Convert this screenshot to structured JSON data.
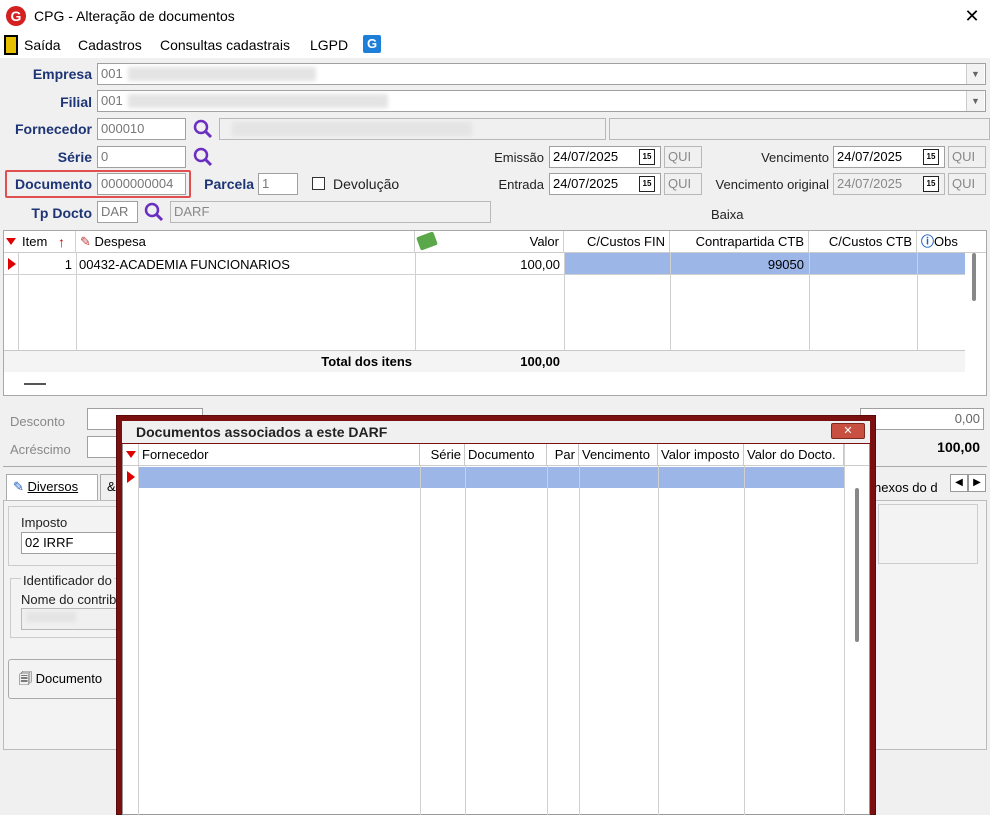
{
  "window": {
    "title": "CPG - Alteração de documentos",
    "close": "✕"
  },
  "menu": [
    "Saída",
    "Cadastros",
    "Consultas cadastrais",
    "LGPD"
  ],
  "form": {
    "empresa_label": "Empresa",
    "empresa_value": "001",
    "filial_label": "Filial",
    "filial_value": "001",
    "fornecedor_label": "Fornecedor",
    "fornecedor_value": "000010",
    "serie_label": "Série",
    "serie_value": "0",
    "documento_label": "Documento",
    "documento_value": "0000000004",
    "parcela_label": "Parcela",
    "parcela_value": "1",
    "devolucao_label": "Devolução",
    "tpdocto_label": "Tp Docto",
    "tpdocto_code": "DAR",
    "tpdocto_desc": "DARF",
    "emissao_label": "Emissão",
    "emissao_value": "24/07/2025",
    "emissao_day": "QUI",
    "entrada_label": "Entrada",
    "entrada_value": "24/07/2025",
    "entrada_day": "QUI",
    "vencimento_label": "Vencimento",
    "vencimento_value": "24/07/2025",
    "vencimento_day": "QUI",
    "vencorig_label": "Vencimento original",
    "vencorig_value": "24/07/2025",
    "vencorig_day": "QUI",
    "baixa_label": "Baixa"
  },
  "items_grid": {
    "headers": {
      "item": "Item",
      "despesa": "Despesa",
      "valor": "Valor",
      "cc_fin": "C/Custos FIN",
      "contrapartida": "Contrapartida CTB",
      "cc_ctb": "C/Custos CTB",
      "obs": "Obs"
    },
    "rows": [
      {
        "item": "1",
        "despesa": "00432-ACADEMIA FUNCIONARIOS",
        "valor": "100,00",
        "cc_fin": "",
        "contrapartida": "99050",
        "cc_ctb": ""
      }
    ],
    "total_label": "Total dos itens",
    "total_value": "100,00"
  },
  "totals": {
    "desconto_label": "Desconto",
    "acrescimo_label": "Acréscimo",
    "right_value_1": "0,00",
    "right_value_2": "100,00"
  },
  "tabs": {
    "diversos": "Diversos",
    "anexos": "nexos do d"
  },
  "lower": {
    "imposto_label": "Imposto",
    "imposto_value": "02 IRRF",
    "identificador_label": "Identificador do",
    "nome_label": "Nome do contrib",
    "documento_button": "Documento"
  },
  "dialog": {
    "title": "Documentos associados a este DARF",
    "headers": {
      "fornecedor": "Fornecedor",
      "serie": "Série",
      "documento": "Documento",
      "par": "Par",
      "vencimento": "Vencimento",
      "valor_imposto": "Valor imposto",
      "valor_docto": "Valor do Docto."
    }
  },
  "colors": {
    "accent": "#1e3575",
    "dialog_border": "#7a1010",
    "selection": "#9db6e8",
    "highlight_box": "#e05050"
  }
}
